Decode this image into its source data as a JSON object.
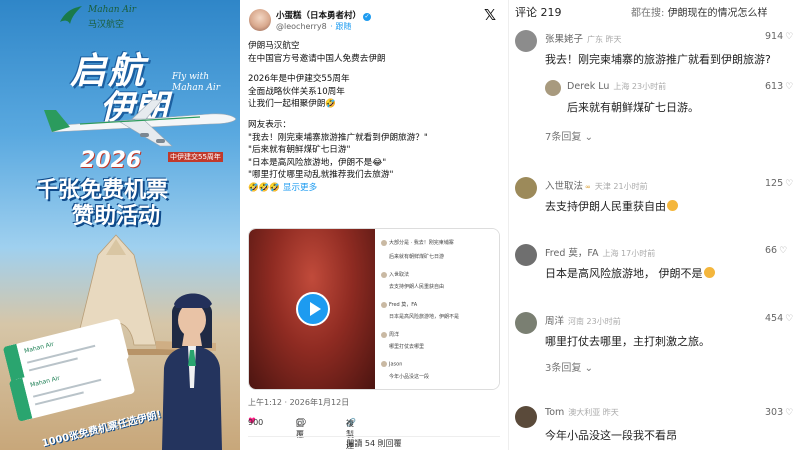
{
  "poster": {
    "logo_en": "Mahan Air",
    "logo_cn": "马汉航空",
    "title_line1": "启航",
    "title_line2": "伊朗",
    "fly_with": "Fly with Mahan Air",
    "year": "2026",
    "year_sub": "中伊建交55周年",
    "promo_line1": "千张免费机票",
    "promo_line2": "赞助活动",
    "ticket_text": "Mahan Air",
    "bottom_line": "1000张免费机票任选伊朗!"
  },
  "tweet": {
    "author_name": "小蛋糕（日本勇者村）",
    "author_handle": "@leocherry8",
    "follow_label": "· 跟随",
    "body_lines": [
      "伊朗马汉航空",
      "在中国官方号邀请中国人免费去伊朗",
      "",
      "2026年是中伊建交55周年",
      "全面战略伙伴关系10周年",
      "让我们一起相聚伊朗🤣",
      "",
      "网友表示：",
      "\"我去！刚完柬埔寨旅游推广就看到伊朗旅游？\"",
      "\"后来就有朝鲜煤矿七日游\"",
      "\"日本是高风险旅游地，伊朗不是😂\"",
      "\"哪里打仗哪里动乱就推荐我们去旅游\"",
      "🤣🤣🤣"
    ],
    "show_more": "显示更多",
    "media_rows": [
      "大部分是 · 我去！刚完柬埔寨",
      "后来就有朝鲜煤矿七日游",
      "入世取法",
      "去支持伊朗人民重获自由",
      "Fred 莫，FA",
      "日本是高风险旅游地，伊朗不是",
      "周洋",
      "哪里打仗去哪里",
      "Jason",
      "今年小品没这一段"
    ],
    "timestamp": "上午1:12 · 2026年1月12日",
    "likes": "900",
    "reply_label": "回覆",
    "copy_link_label": "複製連結",
    "read_replies": "閱讀 54 則回覆"
  },
  "comments": {
    "count_label": "评论 219",
    "search_label": "都在搜:",
    "search_query": "伊朗现在的情况怎么样",
    "items": [
      {
        "name": "张果姥子",
        "badge": "",
        "meta": "广东 昨天",
        "likes": "914",
        "text": "我去！刚完柬埔寨的旅游推广就看到伊朗旅游?",
        "replies": ""
      },
      {
        "name": "入世取法",
        "badge": "∞",
        "meta": "天津 21小时前",
        "likes": "125",
        "text": "去支持伊朗人民重获自由",
        "replies": ""
      },
      {
        "name": "Fred 莫，FA",
        "badge": "",
        "meta": "上海 17小时前",
        "likes": "66",
        "text": "日本是高风险旅游地， 伊朗不是",
        "replies": ""
      },
      {
        "name": "周洋",
        "badge": "",
        "meta": "河南 23小时前",
        "likes": "454",
        "text": "哪里打仗去哪里，主打刺激之旅。",
        "replies": "3条回复"
      },
      {
        "name": "Tom",
        "badge": "",
        "meta": "澳大利亚 昨天",
        "likes": "303",
        "text": "今年小品没这一段我不看昂",
        "replies": ""
      }
    ],
    "sub_reply": {
      "name": "Derek Lu",
      "meta": "上海 23小时前",
      "likes": "613",
      "text": "后来就有朝鲜煤矿七日游。"
    },
    "first_replies": "7条回复",
    "colors": {
      "text": "#222222",
      "meta": "#aaaaaa",
      "badge": "#d89a2a"
    }
  }
}
